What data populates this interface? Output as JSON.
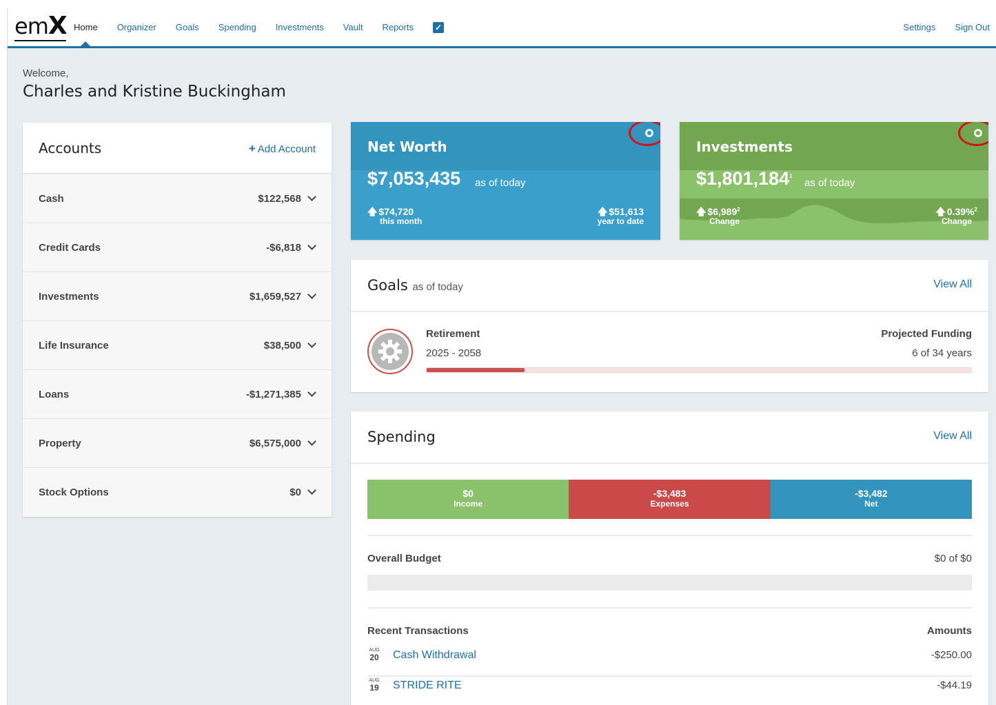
{
  "nav": {
    "logo": "emX",
    "items": [
      "Home",
      "Organizer",
      "Goals",
      "Spending",
      "Investments",
      "Vault",
      "Reports"
    ],
    "active": "Home",
    "right": [
      "Settings",
      "Sign Out"
    ]
  },
  "welcome": {
    "greeting": "Welcome,",
    "name": "Charles and Kristine Buckingham"
  },
  "accounts": {
    "title": "Accounts",
    "add_label": "Add Account",
    "rows": [
      {
        "label": "Cash",
        "amount": "$122,568"
      },
      {
        "label": "Credit Cards",
        "amount": "-$6,818"
      },
      {
        "label": "Investments",
        "amount": "$1,659,527"
      },
      {
        "label": "Life Insurance",
        "amount": "$38,500"
      },
      {
        "label": "Loans",
        "amount": "-$1,271,385"
      },
      {
        "label": "Property",
        "amount": "$6,575,000"
      },
      {
        "label": "Stock Options",
        "amount": "$0"
      }
    ]
  },
  "net_worth": {
    "title": "Net Worth",
    "value": "$7,053,435",
    "as_of": "as of today",
    "month_change": "$74,720",
    "month_label": "this month",
    "ytd_change": "$51,613",
    "ytd_label": "year to date"
  },
  "investments": {
    "title": "Investments",
    "value": "$1,801,184",
    "value_sup": "1",
    "as_of": "as of today",
    "change": "$6,989",
    "change_sup": "2",
    "change_label": "Change",
    "pct_change": "0.39%",
    "pct_sup": "2",
    "pct_label": "Change"
  },
  "goals": {
    "title": "Goals",
    "subtitle": "as of today",
    "view_all": "View All",
    "item": {
      "name": "Retirement",
      "years": "2025 - 2058",
      "proj_label": "Projected Funding",
      "proj_value": "6 of 34 years",
      "progress": 0.18
    }
  },
  "spending": {
    "title": "Spending",
    "view_all": "View All",
    "income": {
      "value": "$0",
      "label": "Income"
    },
    "expenses": {
      "value": "-$3,483",
      "label": "Expenses"
    },
    "net": {
      "value": "-$3,482",
      "label": "Net"
    },
    "budget_label": "Overall Budget",
    "budget_value": "$0 of $0",
    "tx_header": "Recent Transactions",
    "amounts_header": "Amounts",
    "transactions": [
      {
        "month": "AUG",
        "day": "20",
        "name": "Cash Withdrawal",
        "amount": "-$250.00"
      },
      {
        "month": "AUG",
        "day": "19",
        "name": "STRIDE RITE",
        "amount": "-$44.19"
      }
    ]
  },
  "colors": {
    "brand_blue": "#1f6fa5",
    "net_worth_tile": "#3aa0cb",
    "investments_tile": "#8bc16b",
    "expenses_red": "#c94a48",
    "annotation_red": "#d4101a"
  },
  "icons": {
    "tile_settings": "gear-icon",
    "goal": "gear-icon",
    "nav_check": "checkbox-icon",
    "row_expand": "chevron-down-icon"
  }
}
